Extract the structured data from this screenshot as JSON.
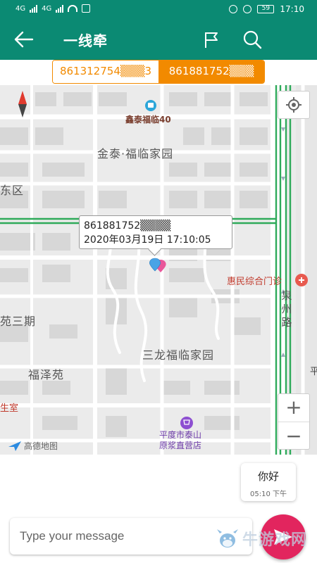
{
  "status_bar": {
    "left_signals": [
      "4G",
      "4G"
    ],
    "battery": "59",
    "time": "17:10"
  },
  "app_bar": {
    "title": "一线牵",
    "icons": [
      "back-arrow-icon",
      "flag-icon",
      "search-icon",
      "chat-bubble-icon"
    ]
  },
  "device_toggle": {
    "options": [
      {
        "label": "861312754▒▒▒3",
        "selected": false
      },
      {
        "label": "861881752▒▒▒",
        "selected": true
      }
    ],
    "accent_color": "#f28a00"
  },
  "map": {
    "poi": {
      "top": "鑫泰福临40",
      "hospital": "惠民综合门诊",
      "shop_line1": "平度市泰山",
      "shop_line2": "原浆直营店"
    },
    "areas": {
      "jintai": "金泰·福临家园",
      "east": "东区",
      "phase3": "苑三期",
      "sanlong": "三龙福临家园",
      "fuze": "福泽苑",
      "health": "生室",
      "edge_right": "平"
    },
    "road": "泉州路",
    "popup": {
      "device": "861881752▒▒▒▒",
      "datetime": "2020年03月19日 17:10:05"
    },
    "logo": "高德地图",
    "zoom_in": "+",
    "zoom_out": "−"
  },
  "chat": {
    "messages": [
      {
        "text": "你好",
        "time": "05:10 下午"
      }
    ]
  },
  "composer": {
    "placeholder": "Type your message"
  },
  "watermark": "牛游戏网",
  "colors": {
    "primary": "#0b8a73",
    "send": "#e2255e",
    "chat_icon": "#3ddc84"
  }
}
